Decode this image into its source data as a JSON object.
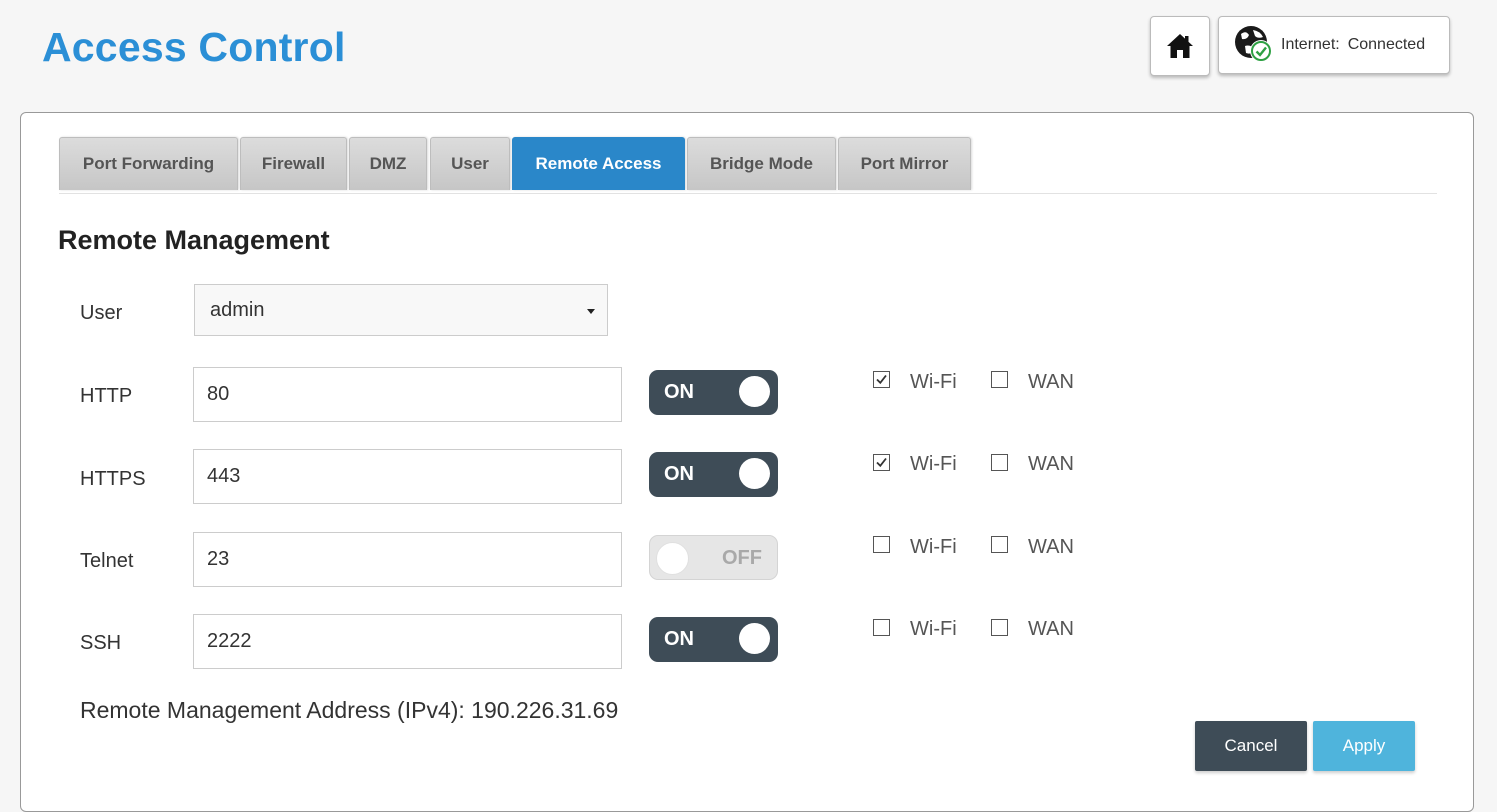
{
  "header": {
    "title": "Access Control",
    "home_icon": "home-icon",
    "status": {
      "icon": "globe-check-icon",
      "label": "Internet:",
      "value": "Connected",
      "accent": "#2ea043"
    }
  },
  "tabs": [
    {
      "label": "Port Forwarding",
      "active": false
    },
    {
      "label": "Firewall",
      "active": false
    },
    {
      "label": "DMZ",
      "active": false
    },
    {
      "label": "User",
      "active": false
    },
    {
      "label": "Remote Access",
      "active": true
    },
    {
      "label": "Bridge Mode",
      "active": false
    },
    {
      "label": "Port Mirror",
      "active": false
    }
  ],
  "section": {
    "title": "Remote Management",
    "user_label": "User",
    "user_value": "admin"
  },
  "protocols": [
    {
      "label": "HTTP",
      "port": "80",
      "toggle": "ON",
      "enabled": true,
      "wifi_label": "Wi-Fi",
      "wifi": true,
      "wan_label": "WAN",
      "wan": false
    },
    {
      "label": "HTTPS",
      "port": "443",
      "toggle": "ON",
      "enabled": true,
      "wifi_label": "Wi-Fi",
      "wifi": true,
      "wan_label": "WAN",
      "wan": false
    },
    {
      "label": "Telnet",
      "port": "23",
      "toggle": "OFF",
      "enabled": false,
      "wifi_label": "Wi-Fi",
      "wifi": false,
      "wan_label": "WAN",
      "wan": false
    },
    {
      "label": "SSH",
      "port": "2222",
      "toggle": "ON",
      "enabled": true,
      "wifi_label": "Wi-Fi",
      "wifi": false,
      "wan_label": "WAN",
      "wan": false
    }
  ],
  "address": {
    "text": "Remote Management Address (IPv4): 190.226.31.69"
  },
  "actions": {
    "cancel_label": "Cancel",
    "apply_label": "Apply"
  },
  "colors": {
    "title": "#2b8fd6",
    "active_tab": "#2a87c9",
    "toggle_on": "#3e4c57",
    "apply": "#4fb4dc"
  }
}
